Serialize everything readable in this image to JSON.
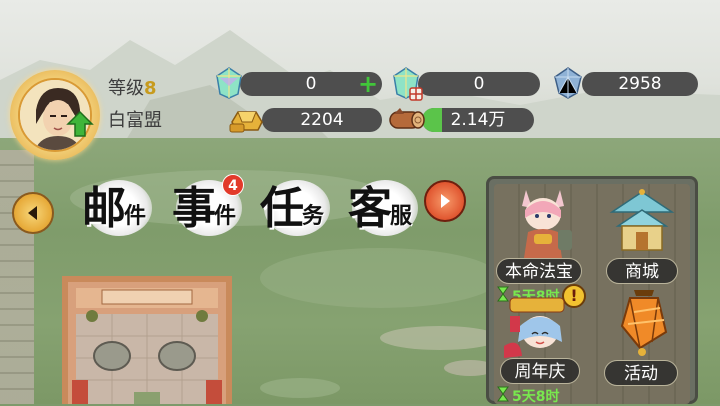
{
  "player": {
    "level_label": "等级",
    "level_value": "8",
    "guild_name": "白富盟"
  },
  "resources": {
    "crystal_a": {
      "value": "0",
      "has_plus": true
    },
    "crystal_b": {
      "value": "0"
    },
    "diamond": {
      "value": "2958"
    },
    "gold": {
      "value": "2204"
    },
    "wood": {
      "value": "2.14万"
    }
  },
  "features": {
    "mail": {
      "big": "邮",
      "small": "件"
    },
    "events": {
      "big": "事",
      "small": "件",
      "badge": "4"
    },
    "tasks": {
      "big": "任",
      "small": "务"
    },
    "service": {
      "big": "客",
      "small": "服"
    }
  },
  "activities": [
    {
      "label": "本命法宝",
      "timer": "5天8时",
      "alert": "!"
    },
    {
      "label": "商城"
    },
    {
      "label": "周年庆",
      "timer": "5天8时"
    },
    {
      "label": "活动"
    }
  ],
  "colors": {
    "accent_gold": "#e6a836",
    "timer_green": "#78e84e",
    "badge_red": "#e23a2a"
  },
  "icons": [
    "left-arrow-icon",
    "right-arrow-icon",
    "crystal-icon",
    "diamond-icon",
    "gold-ingot-icon",
    "wood-log-icon",
    "level-up-arrow-icon",
    "hourglass-icon",
    "alert-icon"
  ]
}
